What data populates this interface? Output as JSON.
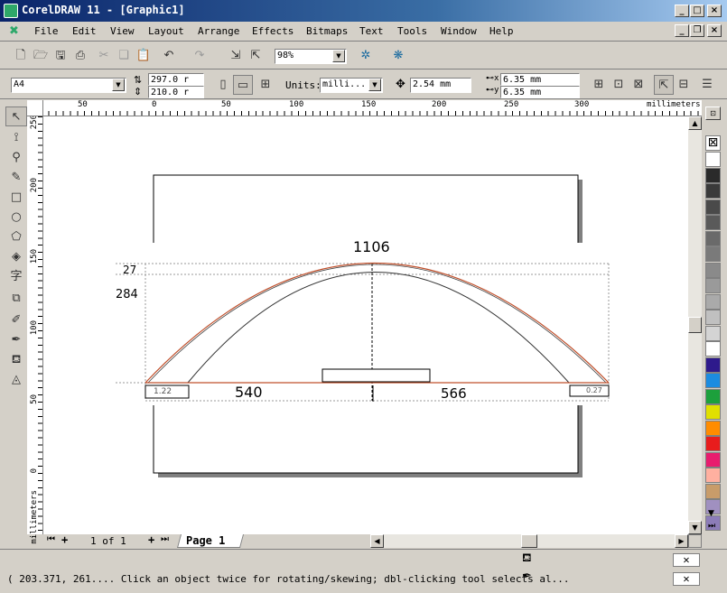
{
  "window": {
    "title": "CorelDRAW 11 - [Graphic1]",
    "min": "_",
    "max": "□",
    "close": "×"
  },
  "menu": [
    "File",
    "Edit",
    "View",
    "Layout",
    "Arrange",
    "Effects",
    "Bitmaps",
    "Text",
    "Tools",
    "Window",
    "Help"
  ],
  "toolbar": {
    "zoom": "98%"
  },
  "props": {
    "paper_size": "A4",
    "width": "297.0 r",
    "height": "210.0 r",
    "units_label": "Units:",
    "units_value": "milli...",
    "nudge": "2.54 mm",
    "dup_x": "6.35 mm",
    "dup_y": "6.35 mm"
  },
  "ruler": {
    "top_ticks": [
      "50",
      "0",
      "50",
      "100",
      "150",
      "200",
      "250",
      "300"
    ],
    "top_unit": "millimeters",
    "left_ticks": [
      "250",
      "200",
      "150",
      "100",
      "50",
      "0"
    ],
    "left_unit": "millimeters"
  },
  "drawing": {
    "dim_top": "1106",
    "dim_27": "27",
    "dim_284": "284",
    "dim_540": "540",
    "dim_566": "566",
    "dim_small_left": "1.22",
    "dim_small_right": "0.27"
  },
  "pagenav": {
    "counter": "1 of 1",
    "tab": "Page 1"
  },
  "status": {
    "text": "( 203.371, 261.... Click an object twice for rotating/skewing; dbl-clicking tool selects al..."
  },
  "palette": [
    "#ffffff",
    "#2a2a2a",
    "#3a3a3a",
    "#4a4a4a",
    "#5a5a5a",
    "#6a6a6a",
    "#7a7a7a",
    "#8a8a8a",
    "#9a9a9a",
    "#aaaaaa",
    "#c0c0c0",
    "#d4d4d4",
    "#ffffff",
    "#2e1a8c",
    "#1c8ce0",
    "#1ca03c",
    "#e0e000",
    "#ff8c00",
    "#e81c1c",
    "#e81c6e",
    "#ffb0a0",
    "#c89c6a",
    "#a090c0",
    "#8c7cb8"
  ]
}
